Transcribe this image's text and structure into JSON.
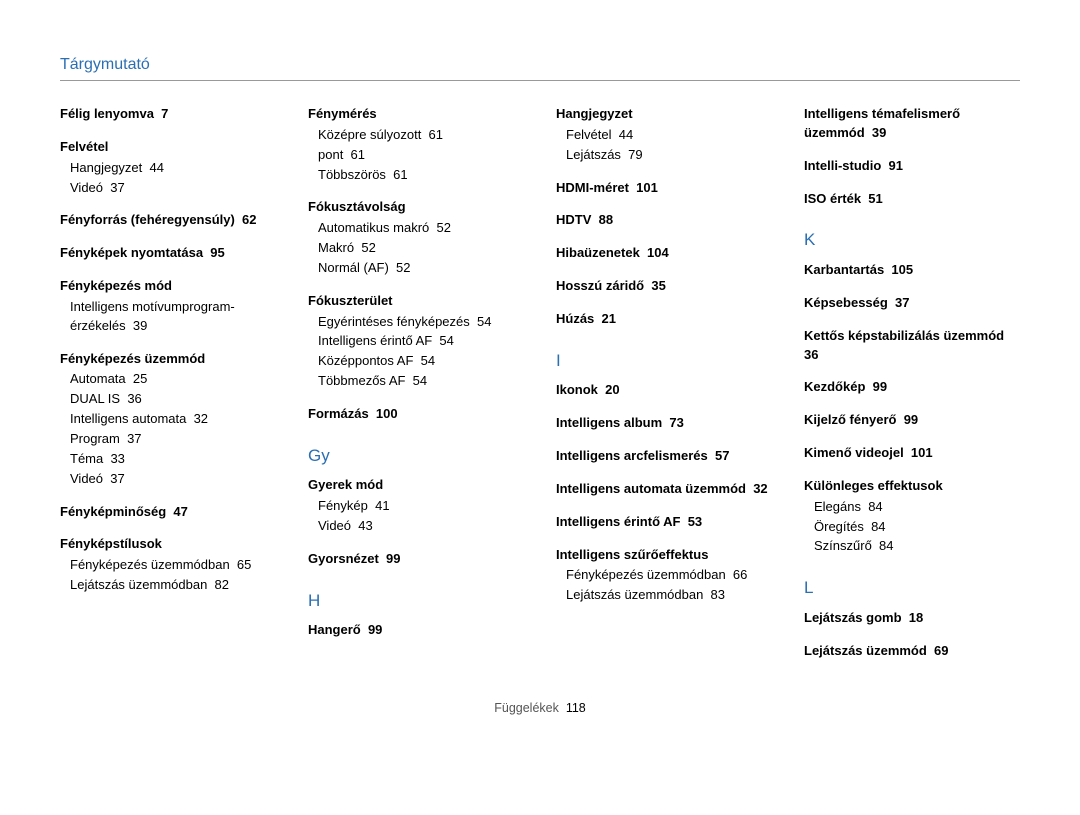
{
  "header": "Tárgymutató",
  "footer_label": "Függelékek",
  "footer_page": "118",
  "columns": [
    {
      "items": [
        {
          "type": "entry",
          "title": "Félig lenyomva",
          "page": "7"
        },
        {
          "type": "entry",
          "title": "Felvétel",
          "subs": [
            {
              "label": "Hangjegyzet",
              "page": "44"
            },
            {
              "label": "Videó",
              "page": "37"
            }
          ]
        },
        {
          "type": "entry",
          "title": "Fényforrás (fehéregyensúly)",
          "page": "62"
        },
        {
          "type": "entry",
          "title": "Fényképek nyomtatása",
          "page": "95"
        },
        {
          "type": "entry",
          "title": "Fényképezés mód",
          "subs": [
            {
              "label": "Intelligens motívumprogram-érzékelés",
              "page": "39"
            }
          ]
        },
        {
          "type": "entry",
          "title": "Fényképezés üzemmód",
          "subs": [
            {
              "label": "Automata",
              "page": "25"
            },
            {
              "label": "DUAL IS",
              "page": "36"
            },
            {
              "label": "Intelligens automata",
              "page": "32"
            },
            {
              "label": "Program",
              "page": "37"
            },
            {
              "label": "Téma",
              "page": "33"
            },
            {
              "label": "Videó",
              "page": "37"
            }
          ]
        },
        {
          "type": "entry",
          "title": "Fényképminőség",
          "page": "47"
        },
        {
          "type": "entry",
          "title": "Fényképstílusok",
          "subs": [
            {
              "label": "Fényképezés üzemmódban",
              "page": "65"
            },
            {
              "label": "Lejátszás üzemmódban",
              "page": "82"
            }
          ]
        }
      ]
    },
    {
      "items": [
        {
          "type": "entry",
          "title": "Fénymérés",
          "subs": [
            {
              "label": "Középre súlyozott",
              "page": "61"
            },
            {
              "label": "pont",
              "page": "61"
            },
            {
              "label": "Többszörös",
              "page": "61"
            }
          ]
        },
        {
          "type": "entry",
          "title": "Fókusztávolság",
          "subs": [
            {
              "label": "Automatikus makró",
              "page": "52"
            },
            {
              "label": "Makró",
              "page": "52"
            },
            {
              "label": "Normál (AF)",
              "page": "52"
            }
          ]
        },
        {
          "type": "entry",
          "title": "Fókuszterület",
          "subs": [
            {
              "label": "Egyérintéses fényképezés",
              "page": "54"
            },
            {
              "label": "Intelligens érintő AF",
              "page": "54"
            },
            {
              "label": "Középpontos AF",
              "page": "54"
            },
            {
              "label": "Többmezős AF",
              "page": "54"
            }
          ]
        },
        {
          "type": "entry",
          "title": "Formázás",
          "page": "100"
        },
        {
          "type": "letter",
          "text": "Gy"
        },
        {
          "type": "entry",
          "title": "Gyerek mód",
          "subs": [
            {
              "label": "Fénykép",
              "page": "41"
            },
            {
              "label": "Videó",
              "page": "43"
            }
          ]
        },
        {
          "type": "entry",
          "title": "Gyorsnézet",
          "page": "99"
        },
        {
          "type": "letter",
          "text": "H"
        },
        {
          "type": "entry",
          "title": "Hangerő",
          "page": "99"
        }
      ]
    },
    {
      "items": [
        {
          "type": "entry",
          "title": "Hangjegyzet",
          "subs": [
            {
              "label": "Felvétel",
              "page": "44"
            },
            {
              "label": "Lejátszás",
              "page": "79"
            }
          ]
        },
        {
          "type": "entry",
          "title": "HDMI-méret",
          "page": "101"
        },
        {
          "type": "entry",
          "title": "HDTV",
          "page": "88"
        },
        {
          "type": "entry",
          "title": "Hibaüzenetek",
          "page": "104"
        },
        {
          "type": "entry",
          "title": "Hosszú záridő",
          "page": "35"
        },
        {
          "type": "entry",
          "title": "Húzás",
          "page": "21"
        },
        {
          "type": "letter",
          "text": "I"
        },
        {
          "type": "entry",
          "title": "Ikonok",
          "page": "20"
        },
        {
          "type": "entry",
          "title": "Intelligens album",
          "page": "73"
        },
        {
          "type": "entry",
          "title": "Intelligens arcfelismerés",
          "page": "57"
        },
        {
          "type": "entry",
          "title": "Intelligens automata üzemmód",
          "page": "32"
        },
        {
          "type": "entry",
          "title": "Intelligens érintő AF",
          "page": "53"
        },
        {
          "type": "entry",
          "title": "Intelligens szűrőeffektus",
          "subs": [
            {
              "label": "Fényképezés üzemmódban",
              "page": "66"
            },
            {
              "label": "Lejátszás üzemmódban",
              "page": "83"
            }
          ]
        }
      ]
    },
    {
      "items": [
        {
          "type": "entry",
          "title": "Intelligens témafelismerő üzemmód",
          "page": "39"
        },
        {
          "type": "entry",
          "title": "Intelli-studio",
          "page": "91"
        },
        {
          "type": "entry",
          "title": "ISO érték",
          "page": "51"
        },
        {
          "type": "letter",
          "text": "K"
        },
        {
          "type": "entry",
          "title": "Karbantartás",
          "page": "105"
        },
        {
          "type": "entry",
          "title": "Képsebesség",
          "page": "37"
        },
        {
          "type": "entry",
          "title": "Kettős képstabilizálás üzemmód",
          "page": "36"
        },
        {
          "type": "entry",
          "title": "Kezdőkép",
          "page": "99"
        },
        {
          "type": "entry",
          "title": "Kijelző fényerő",
          "page": "99"
        },
        {
          "type": "entry",
          "title": "Kimenő videojel",
          "page": "101"
        },
        {
          "type": "entry",
          "title": "Különleges effektusok",
          "subs": [
            {
              "label": "Elegáns",
              "page": "84"
            },
            {
              "label": "Öregítés",
              "page": "84"
            },
            {
              "label": "Színszűrő",
              "page": "84"
            }
          ]
        },
        {
          "type": "letter",
          "text": "L"
        },
        {
          "type": "entry",
          "title": "Lejátszás gomb",
          "page": "18"
        },
        {
          "type": "entry",
          "title": "Lejátszás üzemmód",
          "page": "69"
        }
      ]
    }
  ]
}
